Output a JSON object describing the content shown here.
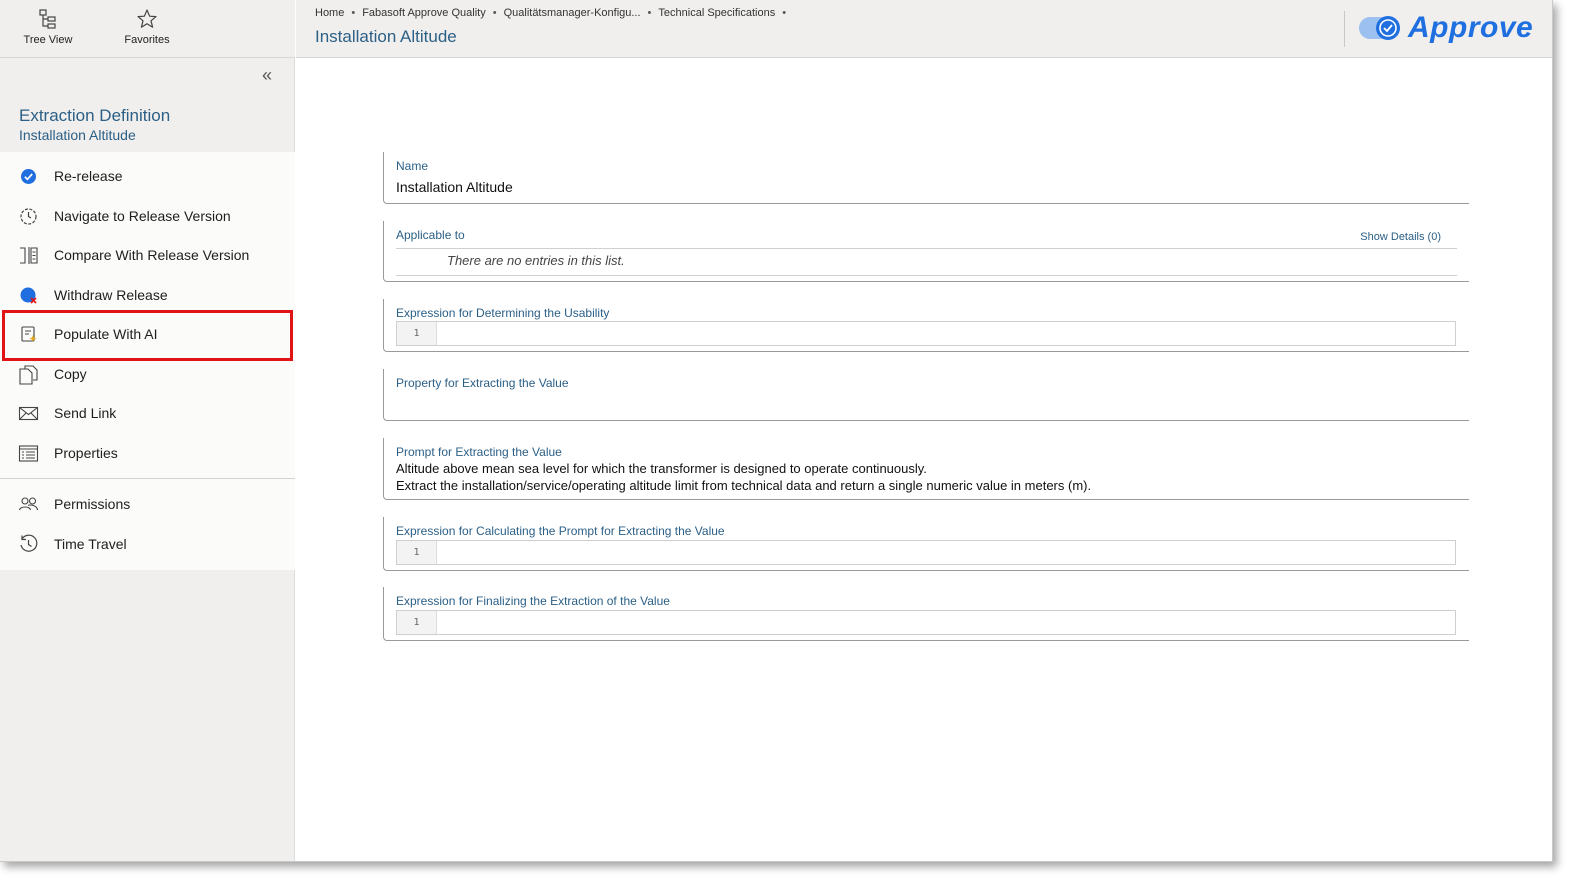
{
  "sidebar": {
    "top_buttons": [
      {
        "label": "Tree View",
        "icon": "tree-view-icon"
      },
      {
        "label": "Favorites",
        "icon": "star-icon"
      }
    ],
    "collapse_glyph": "«",
    "object_type": "Extraction Definition",
    "object_name": "Installation Altitude",
    "actions": [
      {
        "label": "Re-release",
        "icon": "check-circle-icon"
      },
      {
        "label": "Navigate to Release Version",
        "icon": "clock-navigate-icon"
      },
      {
        "label": "Compare With Release Version",
        "icon": "compare-icon"
      },
      {
        "label": "Withdraw Release",
        "icon": "withdraw-icon"
      },
      {
        "label": "Populate With AI",
        "icon": "ai-populate-icon"
      },
      {
        "label": "Copy",
        "icon": "copy-icon"
      },
      {
        "label": "Send Link",
        "icon": "envelope-icon"
      },
      {
        "label": "Properties",
        "icon": "properties-icon"
      },
      {
        "label": "Permissions",
        "icon": "people-icon"
      },
      {
        "label": "Time Travel",
        "icon": "time-travel-icon"
      }
    ]
  },
  "header": {
    "breadcrumb": [
      "Home",
      "Fabasoft Approve Quality",
      "Qualitätsmanager-Konfigu...",
      "Technical Specifications"
    ],
    "breadcrumb_sep": "•",
    "title": "Installation Altitude",
    "logo_text": "Approve"
  },
  "form": {
    "name": {
      "label": "Name",
      "value": "Installation Altitude"
    },
    "applicable_to": {
      "label": "Applicable to",
      "show_details": "Show Details (0)",
      "empty_text": "There are no entries in this list."
    },
    "usability_expression": {
      "label": "Expression for Determining the Usability",
      "line_number": "1"
    },
    "property_extract": {
      "label": "Property for Extracting the Value"
    },
    "prompt_extract": {
      "label": "Prompt for Extracting the Value",
      "line1": "Altitude above mean sea level for which the transformer is designed to operate continuously.",
      "line2": "Extract the installation/service/operating altitude limit from technical data and return a single numeric value in meters (m)."
    },
    "prompt_calc_expression": {
      "label": "Expression for Calculating the Prompt for Extracting the Value",
      "line_number": "1"
    },
    "finalize_expression": {
      "label": "Expression for Finalizing the Extraction of the Value",
      "line_number": "1"
    }
  },
  "colors": {
    "accent": "#2b5f86",
    "highlight": "#e01414",
    "logo": "#1f6fe0"
  }
}
